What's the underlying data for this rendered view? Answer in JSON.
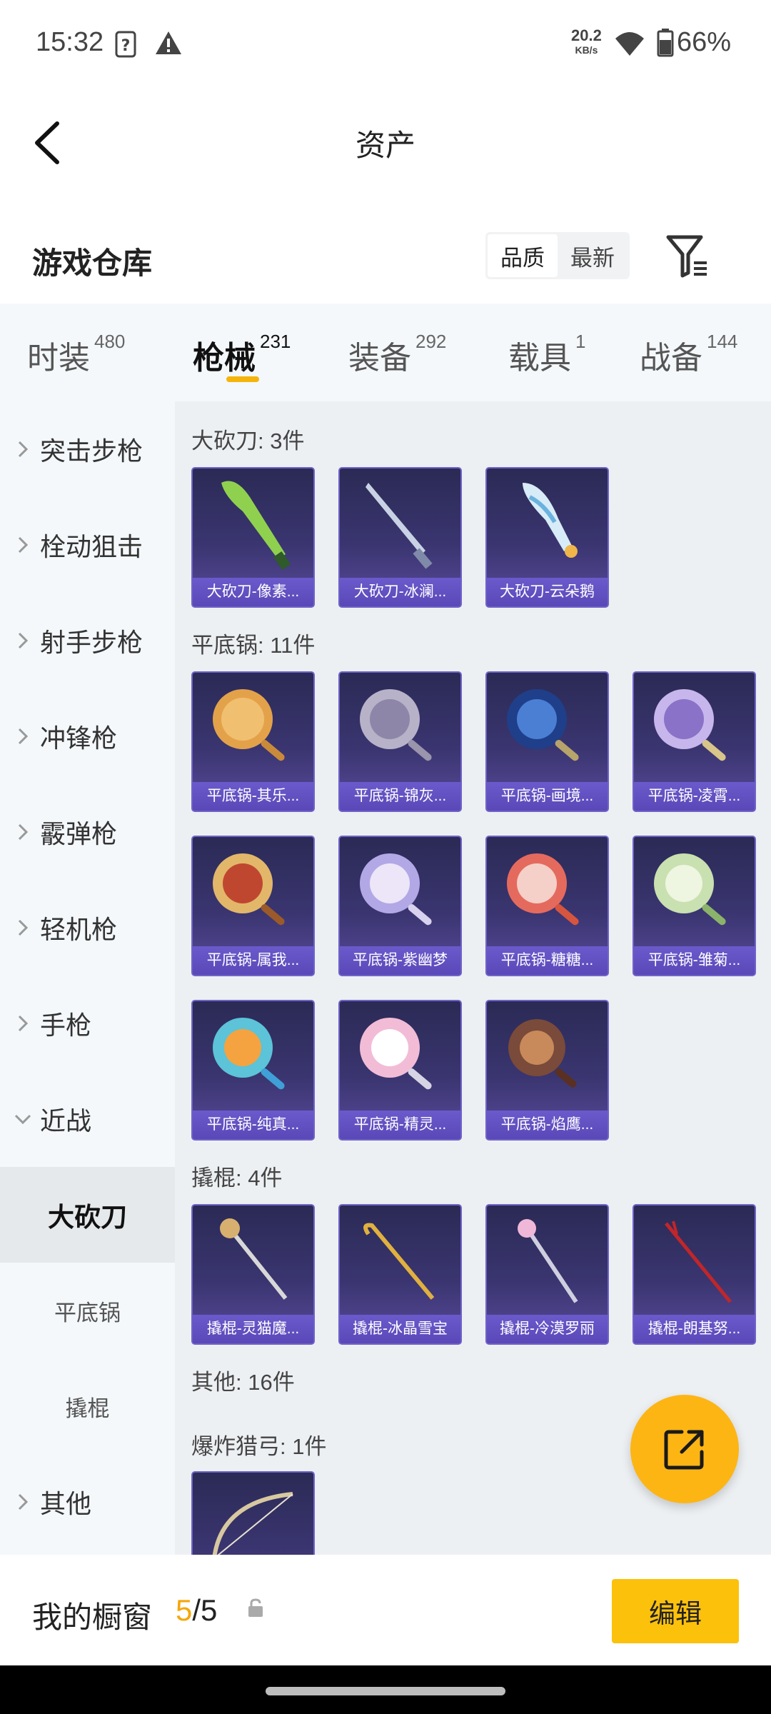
{
  "status_bar": {
    "time": "15:32",
    "net_speed_value": "20.2",
    "net_speed_unit": "KB/s",
    "battery": "66%"
  },
  "header": {
    "title": "资产"
  },
  "warehouse": {
    "title": "游戏仓库",
    "sort_options": [
      "品质",
      "最新"
    ],
    "active_sort": "品质"
  },
  "tabs": [
    {
      "label": "时装",
      "count": "480"
    },
    {
      "label": "枪械",
      "count": "231",
      "active": true
    },
    {
      "label": "装备",
      "count": "292"
    },
    {
      "label": "载具",
      "count": "1"
    },
    {
      "label": "战备",
      "count": "144"
    }
  ],
  "sidebar": {
    "categories": [
      "突击步枪",
      "栓动狙击",
      "射手步枪",
      "冲锋枪",
      "霰弹枪",
      "轻机枪",
      "手枪",
      "近战"
    ],
    "subcategories": [
      "大砍刀",
      "平底锅",
      "撬棍"
    ],
    "other": "其他"
  },
  "sections": {
    "machete": {
      "title": "大砍刀: 3件",
      "items": [
        "大砍刀-像素...",
        "大砍刀-冰澜...",
        "大砍刀-云朵鹅"
      ]
    },
    "pan": {
      "title": "平底锅: 11件",
      "items": [
        "平底锅-其乐...",
        "平底锅-锦灰...",
        "平底锅-画境...",
        "平底锅-凌霄...",
        "平底锅-属我...",
        "平底锅-紫幽梦",
        "平底锅-糖糖...",
        "平底锅-雏菊...",
        "平底锅-纯真...",
        "平底锅-精灵...",
        "平底锅-焰鹰..."
      ]
    },
    "crowbar": {
      "title": "撬棍: 4件",
      "items": [
        "撬棍-灵猫魔...",
        "撬棍-冰晶雪宝",
        "撬棍-冷漠罗丽",
        "撬棍-朗基努..."
      ]
    },
    "other": {
      "title": "其他: 16件"
    },
    "crossbow": {
      "title": "爆炸猎弓: 1件"
    }
  },
  "showcase": {
    "label": "我的橱窗",
    "current": "5",
    "total": "/5",
    "edit_label": "编辑"
  },
  "colors": {
    "accent": "#fcc10b",
    "card_bg": "#2b2a55",
    "card_label": "#5a48b8"
  }
}
